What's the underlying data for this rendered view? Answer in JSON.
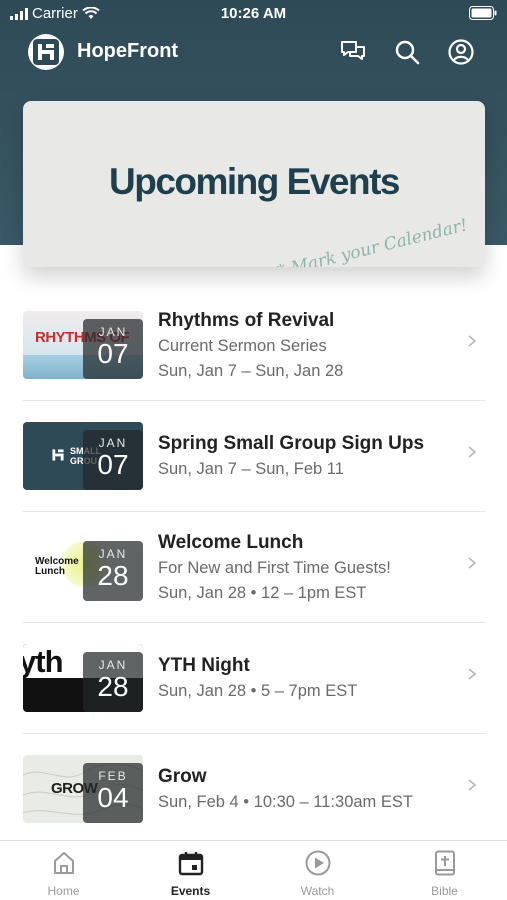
{
  "status": {
    "carrier": "Carrier",
    "time": "10:26 AM"
  },
  "app": {
    "name": "HopeFront"
  },
  "banner": {
    "title": "Upcoming Events",
    "subtitle": "* Mark your Calendar!"
  },
  "events": [
    {
      "title": "Rhythms of Revival",
      "subtitle": "Current Sermon Series",
      "when": "Sun, Jan 7 – Sun, Jan 28",
      "month": "JAN",
      "day": "07",
      "thumb_text": "RHYTHMS OF"
    },
    {
      "title": "Spring Small Group Sign Ups",
      "when": "Sun, Jan 7 – Sun, Feb 11",
      "month": "JAN",
      "day": "07",
      "thumb_text": "SMALL GROU"
    },
    {
      "title": "Welcome Lunch",
      "subtitle": "For New and First Time Guests!",
      "when": "Sun, Jan 28 • 12 – 1pm EST",
      "month": "JAN",
      "day": "28",
      "thumb_text": "Welcome Lunch"
    },
    {
      "title": "YTH Night",
      "when": "Sun, Jan 28 • 5 – 7pm EST",
      "month": "JAN",
      "day": "28",
      "thumb_text": "yth NIGHT"
    },
    {
      "title": "Grow",
      "when": "Sun, Feb 4 • 10:30 – 11:30am EST",
      "month": "FEB",
      "day": "04",
      "thumb_text": "GROW"
    }
  ],
  "tabs": [
    {
      "label": "Home",
      "icon": "home-icon"
    },
    {
      "label": "Events",
      "icon": "calendar-icon",
      "active": true
    },
    {
      "label": "Watch",
      "icon": "play-icon"
    },
    {
      "label": "Bible",
      "icon": "bible-icon"
    }
  ]
}
